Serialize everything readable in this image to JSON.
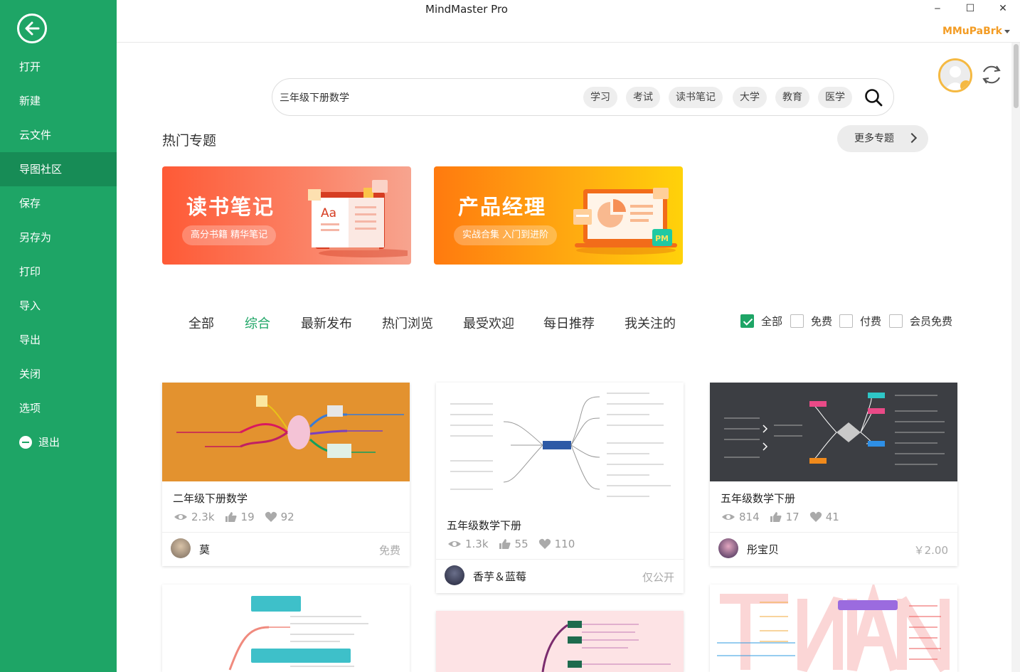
{
  "window": {
    "title": "MindMaster Pro",
    "minimize": "‒",
    "maximize": "☐",
    "close": "✕",
    "username": "MMuPaBrk"
  },
  "sidebar": {
    "items": [
      {
        "label": "打开"
      },
      {
        "label": "新建"
      },
      {
        "label": "云文件"
      },
      {
        "label": "导图社区",
        "active": true
      },
      {
        "label": "保存"
      },
      {
        "label": "另存为"
      },
      {
        "label": "打印"
      },
      {
        "label": "导入"
      },
      {
        "label": "导出"
      },
      {
        "label": "关闭"
      },
      {
        "label": "选项"
      },
      {
        "label": "退出"
      }
    ]
  },
  "search": {
    "value": "三年级下册数学",
    "tags": [
      "学习",
      "考试",
      "读书笔记",
      "大学",
      "教育",
      "医学"
    ]
  },
  "hot": {
    "title": "热门专题",
    "more": "更多专题",
    "banners": [
      {
        "title": "读书笔记",
        "subtitle": "高分书籍 精华笔记",
        "badge": "Aa"
      },
      {
        "title": "产品经理",
        "subtitle": "实战合集 入门到进阶",
        "badge": "PM"
      }
    ]
  },
  "tabs": [
    "全部",
    "综合",
    "最新发布",
    "热门浏览",
    "最受欢迎",
    "每日推荐",
    "我关注的"
  ],
  "active_tab": "综合",
  "filters": [
    {
      "label": "全部",
      "checked": true
    },
    {
      "label": "免费",
      "checked": false
    },
    {
      "label": "付费",
      "checked": false
    },
    {
      "label": "会员免费",
      "checked": false
    }
  ],
  "cards": [
    {
      "title": "二年级下册数学",
      "views": "2.3k",
      "likes": "19",
      "favs": "92",
      "author": "莫",
      "price": "免费"
    },
    {
      "title": "五年级数学下册",
      "views": "1.3k",
      "likes": "55",
      "favs": "110",
      "author": "香芋＆蓝莓",
      "price": "仅公开"
    },
    {
      "title": "五年级数学下册",
      "views": "814",
      "likes": "17",
      "favs": "41",
      "author": "彤宝贝",
      "price": "￥2.00"
    }
  ],
  "colors": {
    "accent": "#1ea566",
    "accent_dark": "#178c56",
    "username": "#f39c24"
  }
}
